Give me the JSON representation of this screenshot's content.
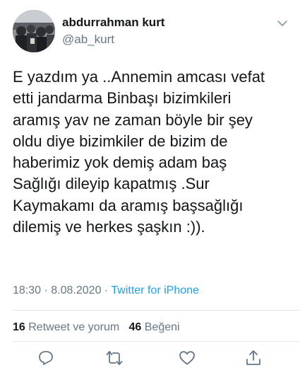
{
  "user": {
    "display_name": "abdurrahman kurt",
    "handle": "@ab_kurt"
  },
  "tweet": {
    "lines": [
      "E yazdım ya ..Annemin amcası vefat",
      "etti jandarma Binbaşı bizimkileri",
      "aramış yav ne zaman böyle bir şey",
      "oldu diye bizimkiler de bizim de",
      "haberimiz yok demiş adam baş",
      "Sağlığı dileyip kapatmış .Sur",
      "Kaymakamı da aramış başsağlığı",
      "dilemiş ve herkes şaşkın :))."
    ],
    "time": "18:30",
    "date": "8.08.2020",
    "separator": "·",
    "source": "Twitter for iPhone"
  },
  "stats": {
    "retweet_count": "16",
    "retweet_label": "Retweet ve yorum",
    "like_count": "46",
    "like_label": "Beğeni"
  },
  "icons": {
    "more": "chevron-down-icon",
    "reply": "reply-icon",
    "retweet": "retweet-icon",
    "like": "heart-icon",
    "share": "share-icon"
  },
  "colors": {
    "text": "#14171a",
    "secondary": "#657786",
    "link": "#1da1f2",
    "icon": "#657786"
  }
}
